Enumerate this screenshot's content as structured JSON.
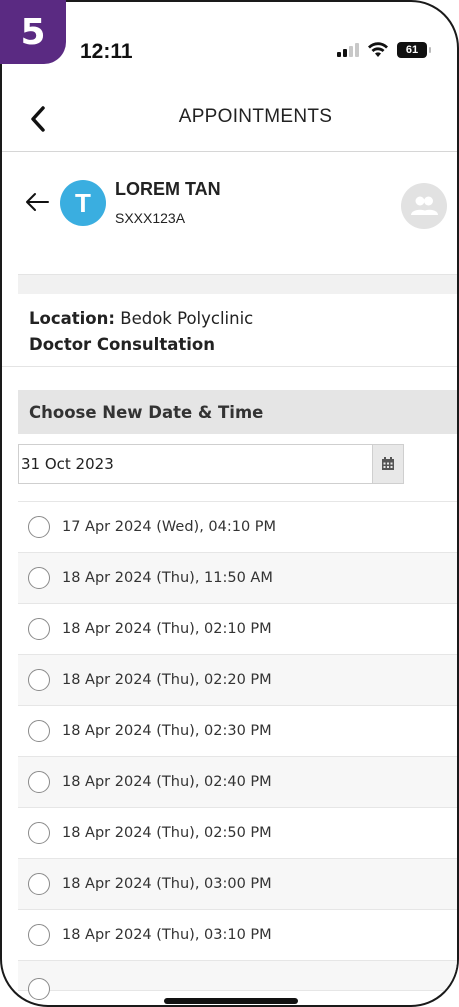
{
  "step_badge": "5",
  "status_bar": {
    "time": "12:11",
    "battery": "61"
  },
  "nav": {
    "title": "APPOINTMENTS"
  },
  "patient": {
    "avatar_initial": "T",
    "name": "LOREM TAN",
    "id": "SXXX123A"
  },
  "appointment": {
    "location_label": "Location:",
    "location_value": "Bedok Polyclinic",
    "service": "Doctor Consultation"
  },
  "section": {
    "title": "Choose New Date & Time"
  },
  "date_field": {
    "value": "31 Oct 2023"
  },
  "slots": [
    "17 Apr 2024 (Wed), 04:10 PM",
    "18 Apr 2024 (Thu), 11:50 AM",
    "18 Apr 2024 (Thu), 02:10 PM",
    "18 Apr 2024 (Thu), 02:20 PM",
    "18 Apr 2024 (Thu), 02:30 PM",
    "18 Apr 2024 (Thu), 02:40 PM",
    "18 Apr 2024 (Thu), 02:50 PM",
    "18 Apr 2024 (Thu), 03:00 PM",
    "18 Apr 2024 (Thu), 03:10 PM"
  ],
  "colors": {
    "badge": "#5a2a82",
    "avatar": "#3aaee0",
    "section_header_bg": "#e5e5e5"
  }
}
